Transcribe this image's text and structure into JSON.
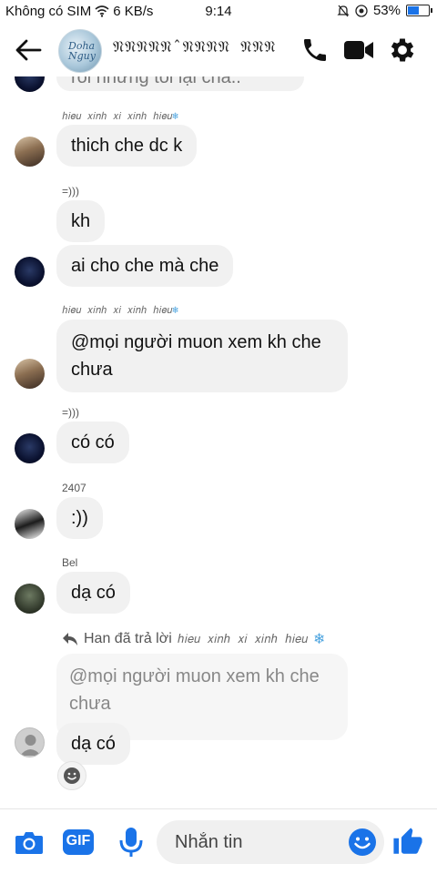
{
  "status_bar": {
    "carrier": "Không có SIM",
    "speed": "6 KB/s",
    "time": "9:14",
    "battery": "53%"
  },
  "header": {
    "title": "𝔑𝔑𝔑𝔑𝔑ˆ𝔑𝔑𝔑𝔑 𝔑𝔑𝔑",
    "avatar_text": "Doha Nguy"
  },
  "messages": {
    "top_partial": "rồi nhưng tôi lại chả..",
    "sender1": "ℎ𝑖𝑒𝑢 𝑥𝑖𝑛ℎ 𝑥𝑖 𝑥𝑖𝑛ℎ ℎ𝑖𝑒𝑢",
    "m1": "thich che dc k",
    "sender2": "=)))",
    "m2": "kh",
    "m3": "ai cho che mà che",
    "sender3": "ℎ𝑖𝑒𝑢 𝑥𝑖𝑛ℎ 𝑥𝑖 𝑥𝑖𝑛ℎ ℎ𝑖𝑒𝑢",
    "m4": "@mọi người muon xem kh che chưa",
    "sender4": "=)))",
    "m5": "có có",
    "sender5": "2407",
    "m6": ":))",
    "sender6": "Bel",
    "m7": "dạ có",
    "reply_prefix": "Han đã trả lời",
    "reply_target": "ℎ𝑖𝑒𝑢 𝑥𝑖𝑛ℎ 𝑥𝑖 𝑥𝑖𝑛ℎ ℎ𝑖𝑒𝑢",
    "quoted": "@mọi người muon xem kh che chưa",
    "m8": "dạ có"
  },
  "composer": {
    "placeholder": "Nhắn tin",
    "gif_label": "GIF"
  },
  "colors": {
    "accent": "#1a73e8",
    "bubble": "#f1f1f1",
    "snowflake": "#4aa3df"
  },
  "icons": [
    "back-arrow-icon",
    "phone-icon",
    "video-icon",
    "gear-icon",
    "camera-icon",
    "gif-icon",
    "mic-icon",
    "emoji-icon",
    "thumbs-up-icon",
    "snowflake-icon",
    "reply-icon",
    "reaction-icon",
    "wifi-icon",
    "alarm-icon",
    "location-icon",
    "battery-icon"
  ]
}
